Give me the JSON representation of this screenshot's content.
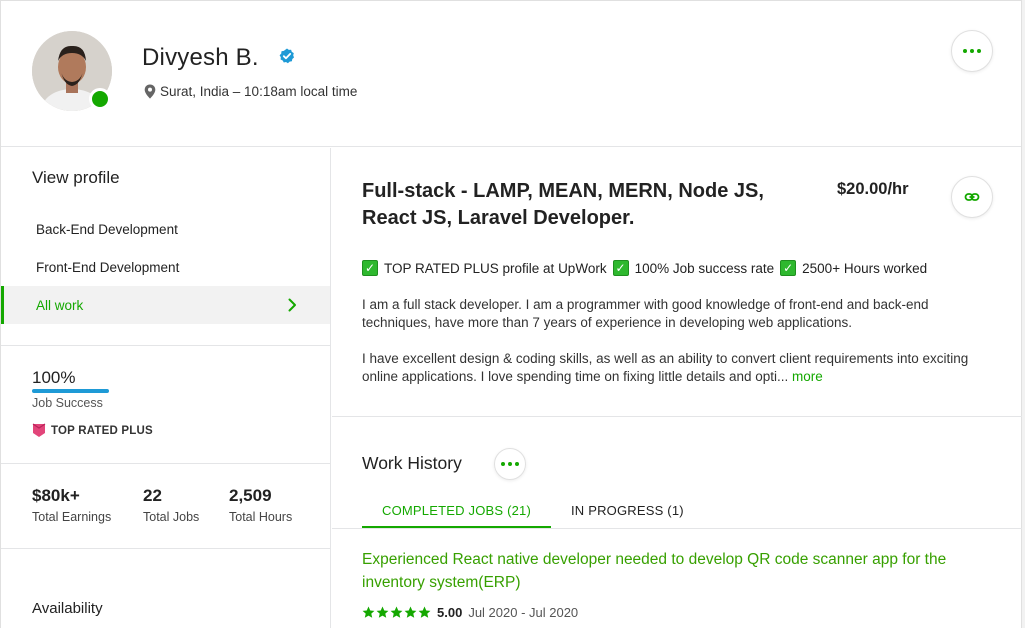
{
  "profile": {
    "name": "Divyesh B.",
    "location": "Surat, India – 10:18am local time"
  },
  "sidebar": {
    "title": "View profile",
    "items": [
      {
        "label": "Back-End Development"
      },
      {
        "label": "Front-End Development"
      },
      {
        "label": "All work"
      }
    ],
    "job_success": {
      "value": "100%",
      "label": "Job Success",
      "fraction": 1.0
    },
    "badge": "TOP RATED PLUS",
    "stats": [
      {
        "value": "$80k+",
        "label": "Total Earnings"
      },
      {
        "value": "22",
        "label": "Total Jobs"
      },
      {
        "value": "2,509",
        "label": "Total Hours"
      }
    ],
    "availability": "Availability"
  },
  "main": {
    "title": "Full-stack - LAMP, MEAN, MERN, Node JS, React JS, Laravel Developer.",
    "rate": "$20.00/hr",
    "highlights": [
      "TOP RATED PLUS profile at UpWork",
      "100% Job success rate",
      "2500+ Hours worked"
    ],
    "description_1": "I am a full stack developer. I am a programmer with good knowledge of front-end and back-end techniques, have more than 7 years of experience in developing web applications.",
    "description_2": "I have excellent design & coding skills, as well as an ability to convert client requirements into exciting online applications. I love spending time on fixing little details and opti...",
    "more_label": "more",
    "work_history": {
      "title": "Work History",
      "tabs": [
        "COMPLETED JOBS (21)",
        "IN PROGRESS (1)"
      ],
      "job": {
        "title": "Experienced React native developer needed to develop QR code scanner app for the inventory system(ERP)",
        "rating": "5.00",
        "rating_value": 5,
        "dates": "Jul 2020 - Jul 2020"
      }
    }
  },
  "colors": {
    "accent_green": "#14a800",
    "job_success_blue": "#1e9ad6",
    "badge_pink": "#e2457a",
    "verified_blue": "#1e9ad6"
  },
  "icons": {
    "verified": "verified-badge-icon",
    "location": "map-pin-icon",
    "more": "ellipsis-icon",
    "link": "link-icon",
    "chevron": "chevron-right-icon",
    "check": "checkbox-icon",
    "star": "star-icon",
    "badge": "top-rated-badge-icon"
  }
}
